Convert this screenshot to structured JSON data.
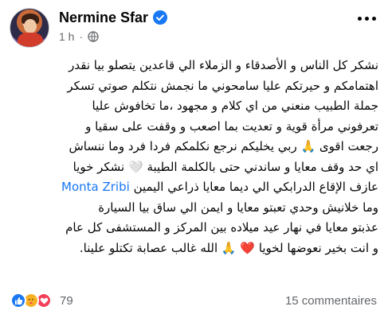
{
  "post": {
    "author": "Nermine Sfar",
    "time": "1 h",
    "separator": "·",
    "lines": [
      "نشكر كل الناس و الأصدقاء و الزملاء الي قاعدين يتصلو بيا نقدر",
      "اهتمامكم و حيرتكم عليا سامحوني ما نجمش نتكلم صوتي تسكر",
      "جملة الطبيب منعني من اي كلام و مجهود ،ما تخافوش عليا",
      "تعرفوني مرأة قوية  و تعديت بما اصعب و وقفت على سقيا و",
      "رجعت اقوى 🙏 ربي يخليكم نرجع نكلمكم فردا فرد وما ننساش",
      "اي حد وقف معايا و ساندني حتى بالكلمة الطيبة 🤍 نشكر خويا",
      "عازف الإقاع الدرابكي الي ديما معايا ذراعي اليمين",
      "وما خلانيش وحدي تعبتو معايا و ايمن  الي ساق بيا السيارة",
      "عذبتو معايا في نهار عيد ميلاده بين المركز و المستشفى كل عام",
      "و انت بخير نعوضها لخويا ❤️ 🙏 الله غالب عصابة تكتلو علينا."
    ],
    "mention": "Monta Zribi"
  },
  "footer": {
    "reaction_count": "79",
    "comments": "15 commentaires"
  },
  "icons": {
    "verified": "verified-badge-icon",
    "privacy": "globe-icon",
    "options": "more-options-icon",
    "reactions": [
      "like-icon",
      "care-icon",
      "love-icon"
    ]
  },
  "colors": {
    "accent": "#1877f2",
    "secondary_text": "#65676b",
    "love": "#f33e58",
    "care": "#f7b125"
  }
}
